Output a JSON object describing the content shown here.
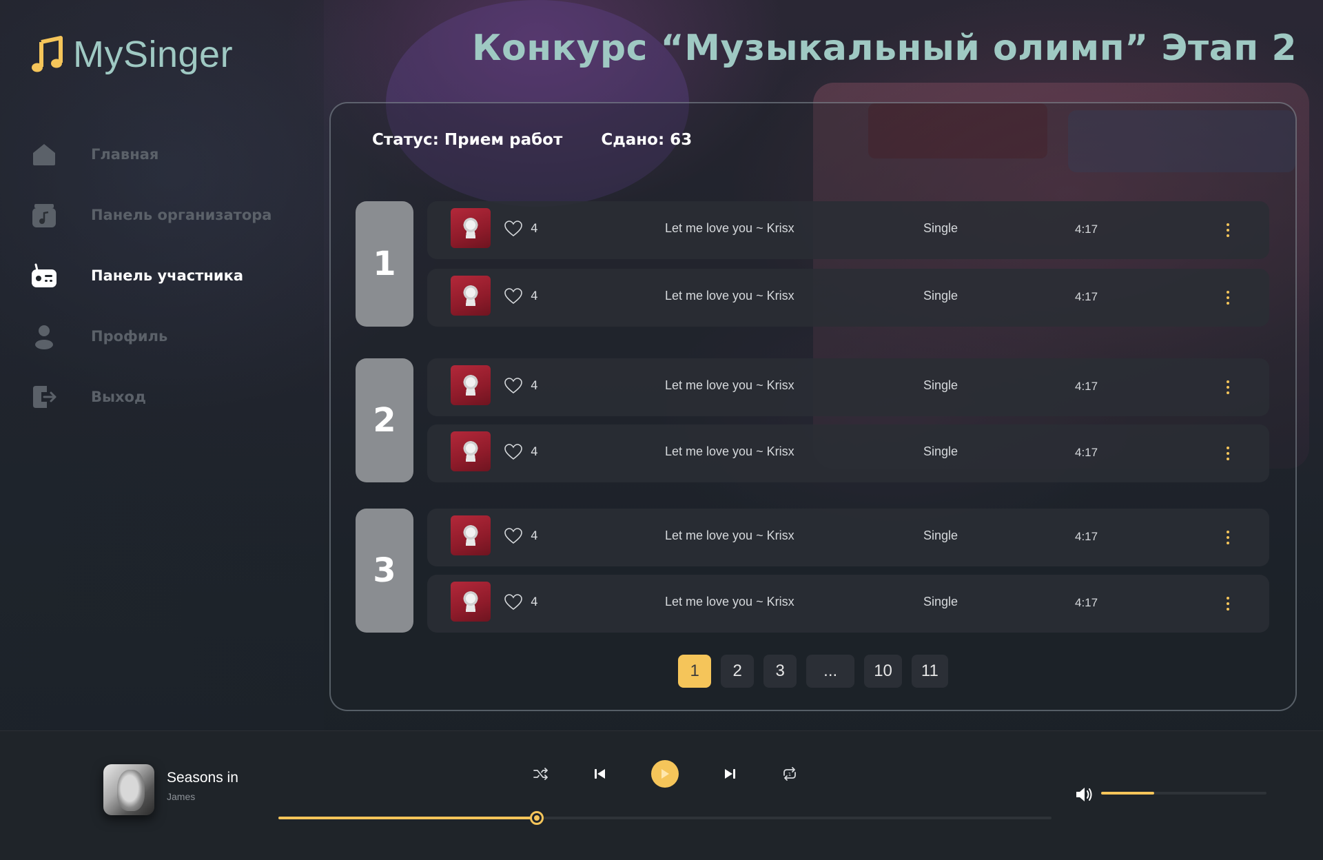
{
  "app": {
    "name": "MySinger"
  },
  "header": {
    "title": "Конкурс “Музыкальный олимп” Этап 2"
  },
  "sidebar": {
    "items": [
      {
        "label": "Главная",
        "icon": "home-icon",
        "active": false
      },
      {
        "label": "Панель организатора",
        "icon": "music-folder-icon",
        "active": false
      },
      {
        "label": "Панель участника",
        "icon": "radio-icon",
        "active": true
      },
      {
        "label": "Профиль",
        "icon": "user-icon",
        "active": false
      },
      {
        "label": "Выход",
        "icon": "logout-icon",
        "active": false
      }
    ]
  },
  "contest": {
    "status": "Статус: Прием работ",
    "submitted": "Сдано: 63",
    "groups": [
      {
        "number": "1",
        "tracks": [
          {
            "likes": "4",
            "title": "Let me love you ~ Krisx",
            "type": "Single",
            "duration": "4:17"
          },
          {
            "likes": "4",
            "title": "Let me love you ~ Krisx",
            "type": "Single",
            "duration": "4:17"
          }
        ]
      },
      {
        "number": "2",
        "tracks": [
          {
            "likes": "4",
            "title": "Let me love you ~ Krisx",
            "type": "Single",
            "duration": "4:17"
          },
          {
            "likes": "4",
            "title": "Let me love you ~ Krisx",
            "type": "Single",
            "duration": "4:17"
          }
        ]
      },
      {
        "number": "3",
        "tracks": [
          {
            "likes": "4",
            "title": "Let me love you ~ Krisx",
            "type": "Single",
            "duration": "4:17"
          },
          {
            "likes": "4",
            "title": "Let me love you ~ Krisx",
            "type": "Single",
            "duration": "4:17"
          }
        ]
      }
    ]
  },
  "pagination": {
    "pages": [
      "1",
      "2",
      "3",
      "...",
      "10",
      "11"
    ],
    "current": "1"
  },
  "player": {
    "title": "Seasons in",
    "artist": "James",
    "progress": 0.334,
    "volume": 0.32
  },
  "colors": {
    "accent": "#f5c55a",
    "title": "#9fc9c3",
    "panel_bg": "#2a2e34"
  }
}
